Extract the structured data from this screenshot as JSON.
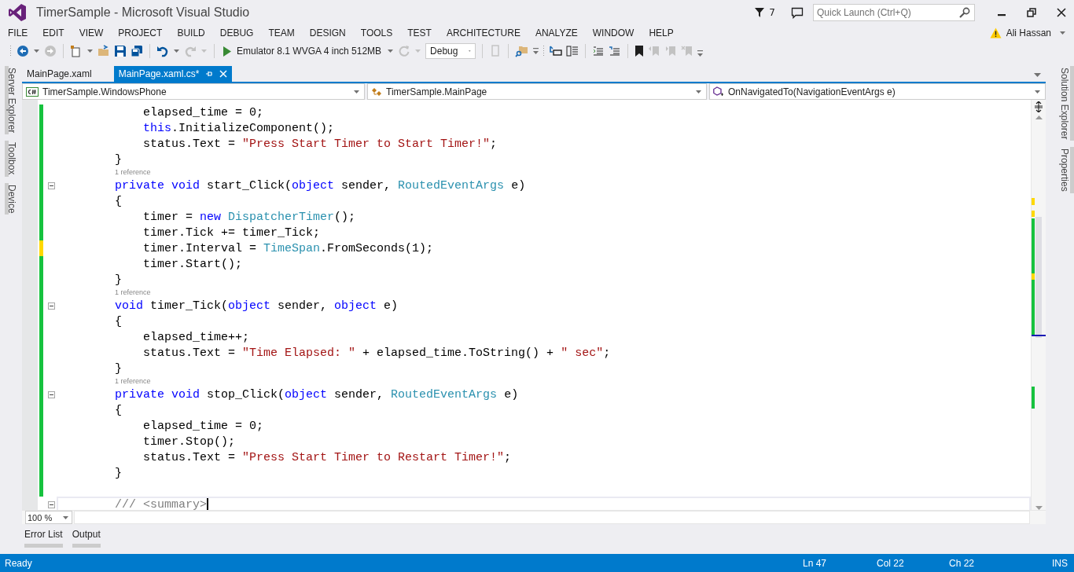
{
  "window": {
    "title": "TimerSample - Microsoft Visual Studio"
  },
  "title_bar": {
    "notifications": "7",
    "quick_launch": {
      "placeholder": "Quick Launch (Ctrl+Q)"
    }
  },
  "menu": [
    "FILE",
    "EDIT",
    "VIEW",
    "PROJECT",
    "BUILD",
    "DEBUG",
    "TEAM",
    "DESIGN",
    "TOOLS",
    "TEST",
    "ARCHITECTURE",
    "ANALYZE",
    "WINDOW",
    "HELP"
  ],
  "account": {
    "name": "Ali Hassan",
    "warning": true
  },
  "toolbar": {
    "run_target": "Emulator 8.1 WVGA 4 inch 512MB",
    "configuration": "Debug"
  },
  "left_panels": [
    {
      "label": "Server Explorer"
    },
    {
      "label": "Toolbox"
    },
    {
      "label": "Device"
    }
  ],
  "right_panels": [
    {
      "label": "Solution Explorer"
    },
    {
      "label": "Properties"
    }
  ],
  "tabs": [
    {
      "label": "MainPage.xaml",
      "selected": false
    },
    {
      "label": "MainPage.xaml.cs*",
      "selected": true
    }
  ],
  "nav": {
    "project": "TimerSample.WindowsPhone",
    "type": "TimerSample.MainPage",
    "member": "OnNavigatedTo(NavigationEventArgs e)"
  },
  "code": [
    {
      "kind": "code",
      "changed": true,
      "saved": true,
      "fold": false,
      "current": false,
      "tokens": [
        {
          "text": "        elapsed_time = 0;"
        }
      ]
    },
    {
      "kind": "code",
      "changed": true,
      "saved": true,
      "fold": false,
      "current": false,
      "tokens": [
        {
          "keyword": "        this"
        },
        {
          "text": ".InitializeComponent();"
        }
      ]
    },
    {
      "kind": "code",
      "changed": true,
      "saved": true,
      "fold": false,
      "current": false,
      "tokens": [
        {
          "text": "        status.Text = "
        },
        {
          "string": "\"Press Start Timer to Start Timer!\""
        },
        {
          "text": ";"
        }
      ]
    },
    {
      "kind": "code",
      "changed": true,
      "saved": true,
      "fold": false,
      "current": false,
      "tokens": [
        {
          "text": "    }"
        }
      ]
    },
    {
      "kind": "ref",
      "changed": true,
      "saved": true,
      "text": "1 reference"
    },
    {
      "kind": "code",
      "changed": true,
      "saved": true,
      "fold": true,
      "current": false,
      "tokens": [
        {
          "keyword": "    private void "
        },
        {
          "text": "start_Click("
        },
        {
          "keyword": "object"
        },
        {
          "text": " sender, "
        },
        {
          "type": "RoutedEventArgs"
        },
        {
          "text": " e)"
        }
      ]
    },
    {
      "kind": "code",
      "changed": true,
      "saved": true,
      "fold": false,
      "current": false,
      "tokens": [
        {
          "text": "    {"
        }
      ]
    },
    {
      "kind": "code",
      "changed": true,
      "saved": true,
      "fold": false,
      "current": false,
      "tokens": [
        {
          "text": "        timer = "
        },
        {
          "keyword": "new "
        },
        {
          "type": "DispatcherTimer"
        },
        {
          "text": "();"
        }
      ]
    },
    {
      "kind": "code",
      "changed": true,
      "saved": true,
      "fold": false,
      "current": false,
      "tokens": [
        {
          "text": "        timer.Tick += timer_Tick;"
        }
      ]
    },
    {
      "kind": "code",
      "changed": true,
      "saved": false,
      "fold": false,
      "current": false,
      "tokens": [
        {
          "text": "        timer.Interval = "
        },
        {
          "type": "TimeSpan"
        },
        {
          "text": ".FromSeconds(1);"
        }
      ]
    },
    {
      "kind": "code",
      "changed": true,
      "saved": true,
      "fold": false,
      "current": false,
      "tokens": [
        {
          "text": "        timer.Start();"
        }
      ]
    },
    {
      "kind": "code",
      "changed": true,
      "saved": true,
      "fold": false,
      "current": false,
      "tokens": [
        {
          "text": "    }"
        }
      ]
    },
    {
      "kind": "ref",
      "changed": true,
      "saved": true,
      "text": "1 reference"
    },
    {
      "kind": "code",
      "changed": true,
      "saved": true,
      "fold": true,
      "current": false,
      "tokens": [
        {
          "keyword": "    void "
        },
        {
          "text": "timer_Tick("
        },
        {
          "keyword": "object"
        },
        {
          "text": " sender, "
        },
        {
          "keyword": "object"
        },
        {
          "text": " e)"
        }
      ]
    },
    {
      "kind": "code",
      "changed": true,
      "saved": true,
      "fold": false,
      "current": false,
      "tokens": [
        {
          "text": "    {"
        }
      ]
    },
    {
      "kind": "code",
      "changed": true,
      "saved": true,
      "fold": false,
      "current": false,
      "tokens": [
        {
          "text": "        elapsed_time++;"
        }
      ]
    },
    {
      "kind": "code",
      "changed": true,
      "saved": true,
      "fold": false,
      "current": false,
      "tokens": [
        {
          "text": "        status.Text = "
        },
        {
          "string": "\"Time Elapsed: \""
        },
        {
          "text": " + elapsed_time.ToString() + "
        },
        {
          "string": "\" sec\""
        },
        {
          "text": ";"
        }
      ]
    },
    {
      "kind": "code",
      "changed": true,
      "saved": true,
      "fold": false,
      "current": false,
      "tokens": [
        {
          "text": "    }"
        }
      ]
    },
    {
      "kind": "ref",
      "changed": true,
      "saved": true,
      "text": "1 reference"
    },
    {
      "kind": "code",
      "changed": true,
      "saved": true,
      "fold": true,
      "current": false,
      "tokens": [
        {
          "keyword": "    private void "
        },
        {
          "text": "stop_Click("
        },
        {
          "keyword": "object"
        },
        {
          "text": " sender, "
        },
        {
          "type": "RoutedEventArgs"
        },
        {
          "text": " e)"
        }
      ]
    },
    {
      "kind": "code",
      "changed": true,
      "saved": true,
      "fold": false,
      "current": false,
      "tokens": [
        {
          "text": "    {"
        }
      ]
    },
    {
      "kind": "code",
      "changed": true,
      "saved": true,
      "fold": false,
      "current": false,
      "tokens": [
        {
          "text": "        elapsed_time = 0;"
        }
      ]
    },
    {
      "kind": "code",
      "changed": true,
      "saved": true,
      "fold": false,
      "current": false,
      "tokens": [
        {
          "text": "        timer.Stop();"
        }
      ]
    },
    {
      "kind": "code",
      "changed": true,
      "saved": true,
      "fold": false,
      "current": false,
      "tokens": [
        {
          "text": "        status.Text = "
        },
        {
          "string": "\"Press Start Timer to Restart Timer!\""
        },
        {
          "text": ";"
        }
      ]
    },
    {
      "kind": "code",
      "changed": true,
      "saved": true,
      "fold": false,
      "current": false,
      "tokens": [
        {
          "text": "    }"
        }
      ]
    },
    {
      "kind": "code",
      "changed": true,
      "saved": true,
      "fold": false,
      "current": false
    },
    {
      "kind": "code",
      "changed": false,
      "fold": true,
      "current": true,
      "tokens": [
        {
          "comment": "    /// <summary>"
        }
      ]
    }
  ],
  "zoom": "100 %",
  "tool_tabs": [
    {
      "label": "Error List"
    },
    {
      "label": "Output"
    }
  ],
  "status_bar": {
    "state": "Ready",
    "line": "Ln 47",
    "col": "Col 22",
    "ch": "Ch 22",
    "mode": "INS"
  }
}
